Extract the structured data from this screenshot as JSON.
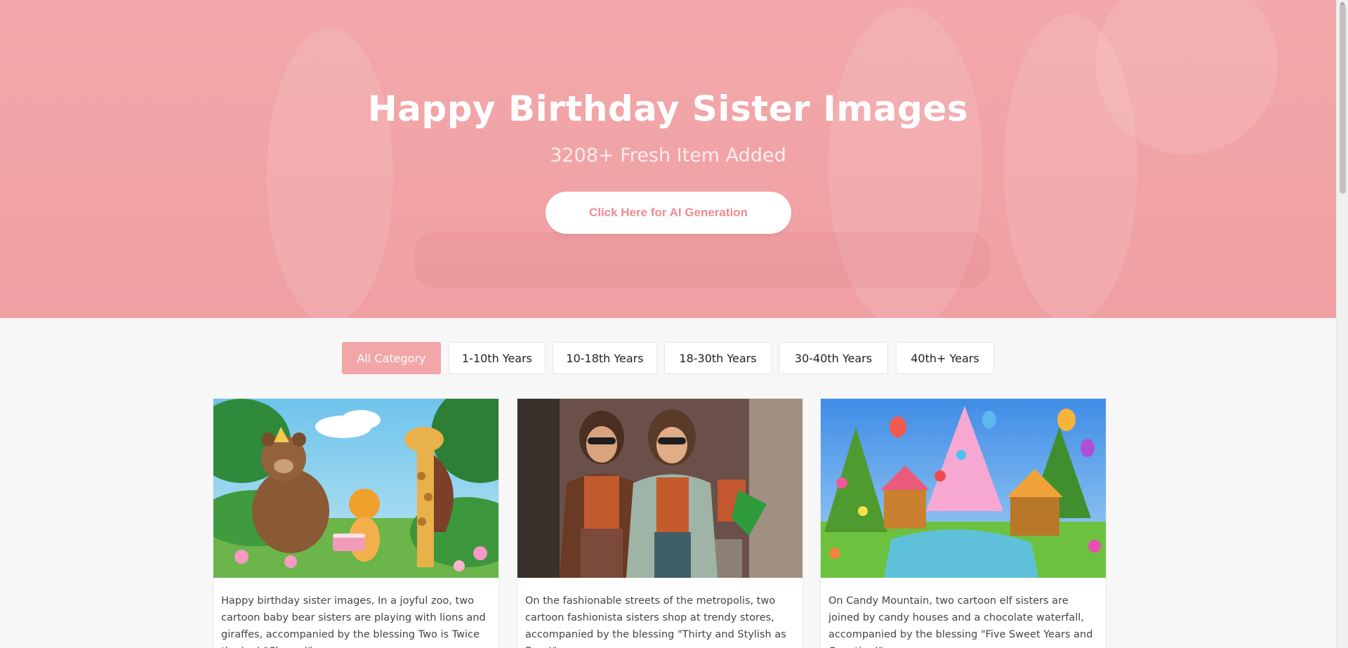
{
  "hero": {
    "title": "Happy Birthday Sister Images",
    "subtitle": "3208+ Fresh Item Added",
    "cta_label": "Click Here for AI Generation"
  },
  "filters": [
    {
      "label": "All Category",
      "active": true
    },
    {
      "label": "1-10th Years",
      "active": false
    },
    {
      "label": "10-18th Years",
      "active": false
    },
    {
      "label": "18-30th Years",
      "active": false
    },
    {
      "label": "30-40th Years",
      "active": false
    },
    {
      "label": "40th+ Years",
      "active": false
    }
  ],
  "cards": [
    {
      "image": "cartoon-zoo-bear-giraffe-lion-illustration",
      "text": "Happy birthday sister images, In a joyful zoo, two cartoon baby bear sisters are playing with lions and giraffes, accompanied by the blessing Two is Twice the Joy! \"Cheers!\""
    },
    {
      "image": "two-sisters-shopping-street-photo",
      "text": "On the fashionable streets of the metropolis, two cartoon fashionista sisters shop at trendy stores, accompanied by the blessing \"Thirty and Stylish as Ever!\""
    },
    {
      "image": "candy-mountain-houses-balloons-illustration",
      "text": "On Candy Mountain, two cartoon elf sisters are joined by candy houses and a chocolate waterfall, accompanied by the blessing \"Five Sweet Years and Counting!\""
    }
  ],
  "colors": {
    "hero_bg": "#f2a8aa",
    "accent": "#f2a6a9",
    "cta_text": "#ef8c93"
  }
}
